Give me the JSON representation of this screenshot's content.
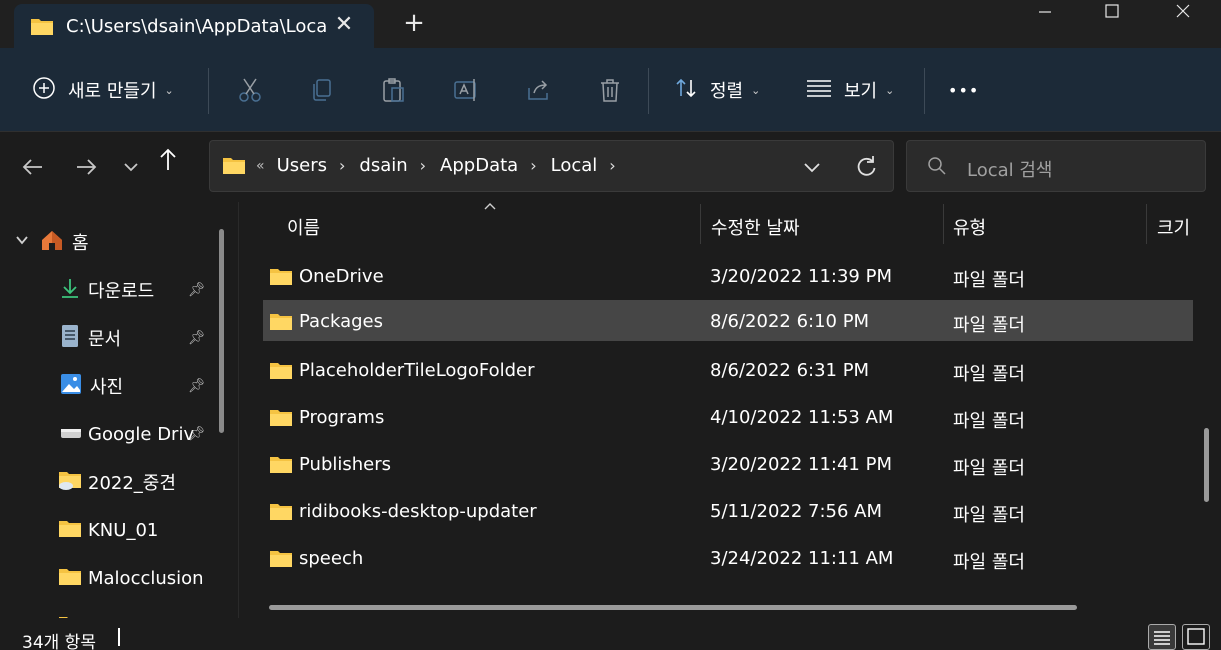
{
  "titlebar": {
    "tab_title": "C:\\Users\\dsain\\AppData\\Local",
    "close_tab": "✕",
    "new_tab": "+",
    "minimize": "—",
    "maximize": "☐",
    "close_window": "✕"
  },
  "commandbar": {
    "new_label": "새로 만들기",
    "sort_label": "정렬",
    "view_label": "보기",
    "more_label": "•••"
  },
  "nav": {
    "breadcrumbs": [
      "Users",
      "dsain",
      "AppData",
      "Local"
    ],
    "overflow": "«",
    "search_placeholder": "Local 검색"
  },
  "sidebar": {
    "home": "홈",
    "items": [
      {
        "label": "다운로드",
        "pinned": true,
        "icon": "download-icon"
      },
      {
        "label": "문서",
        "pinned": true,
        "icon": "document-icon"
      },
      {
        "label": "사진",
        "pinned": true,
        "icon": "picture-icon"
      },
      {
        "label": "Google Driv",
        "pinned": true,
        "icon": "drive-icon"
      },
      {
        "label": "2022_중견",
        "pinned": false,
        "icon": "cloud-folder-icon"
      },
      {
        "label": "KNU_01",
        "pinned": false,
        "icon": "folder-icon"
      },
      {
        "label": "Malocclusion",
        "pinned": false,
        "icon": "folder-icon"
      }
    ]
  },
  "columns": {
    "name": "이름",
    "modified": "수정한 날짜",
    "type": "유형",
    "size": "크기"
  },
  "files": [
    {
      "name": "OneDrive",
      "modified": "3/20/2022 11:39 PM",
      "type": "파일 폴더",
      "selected": false
    },
    {
      "name": "Packages",
      "modified": "8/6/2022 6:10 PM",
      "type": "파일 폴더",
      "selected": true
    },
    {
      "name": "PlaceholderTileLogoFolder",
      "modified": "8/6/2022 6:31 PM",
      "type": "파일 폴더",
      "selected": false
    },
    {
      "name": "Programs",
      "modified": "4/10/2022 11:53 AM",
      "type": "파일 폴더",
      "selected": false
    },
    {
      "name": "Publishers",
      "modified": "3/20/2022 11:41 PM",
      "type": "파일 폴더",
      "selected": false
    },
    {
      "name": "ridibooks-desktop-updater",
      "modified": "5/11/2022 7:56 AM",
      "type": "파일 폴더",
      "selected": false
    },
    {
      "name": "speech",
      "modified": "3/24/2022 11:11 AM",
      "type": "파일 폴더",
      "selected": false
    }
  ],
  "status": {
    "item_count": "34개 항목"
  },
  "colors": {
    "accent_bar": "#1c2a38",
    "folder": "#f5c342",
    "selected_row": "#464646"
  }
}
